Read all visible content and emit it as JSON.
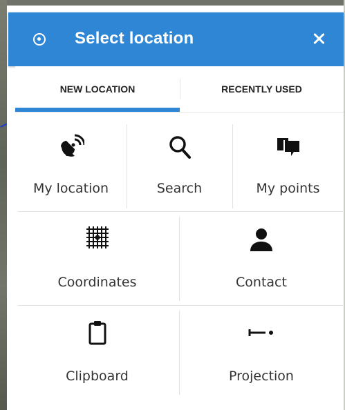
{
  "dialog": {
    "title": "Select location",
    "tabs": [
      {
        "label": "NEW LOCATION",
        "active": true
      },
      {
        "label": "RECENTLY USED",
        "active": false
      }
    ],
    "options": [
      {
        "label": "My location",
        "icon": "satellite-dish-icon"
      },
      {
        "label": "Search",
        "icon": "search-icon"
      },
      {
        "label": "My points",
        "icon": "chat-bubbles-icon"
      },
      {
        "label": "Coordinates",
        "icon": "grid-coordinates-icon"
      },
      {
        "label": "Contact",
        "icon": "person-icon"
      },
      {
        "label": "Clipboard",
        "icon": "clipboard-icon"
      },
      {
        "label": "Projection",
        "icon": "projection-icon"
      }
    ]
  },
  "colors": {
    "header": "#2f86d4",
    "tab_indicator": "#2f86d4",
    "text": "#333333"
  }
}
